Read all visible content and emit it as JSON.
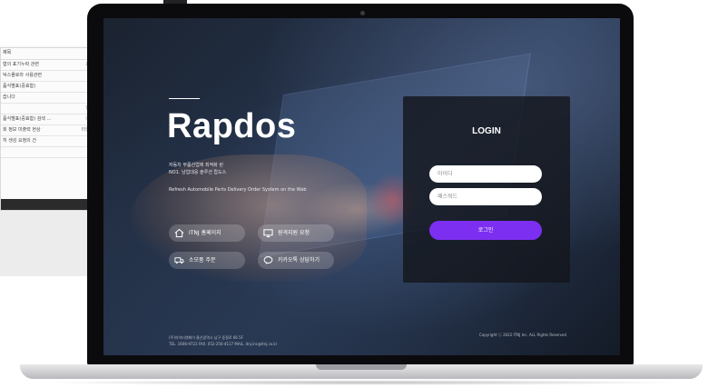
{
  "background_doc": {
    "header": "제목",
    "rows": [
      {
        "text": "협의 표기누락 관련",
        "right": "요"
      },
      {
        "text": "덕스몰로라 사용관련",
        "right": ""
      },
      {
        "text": "품식별표(중효함)",
        "right": ""
      },
      {
        "text": "습니다",
        "right": ""
      },
      {
        "text": "",
        "right": "안"
      },
      {
        "text": "품식별표(중효함) 검색 ...",
        "right": "나"
      },
      {
        "text": "회 정보 미출력 현상",
        "right": "타입"
      },
      {
        "text": "히 생성 요청의 건",
        "right": ""
      },
      {
        "text": "",
        "right": ""
      }
    ]
  },
  "site": {
    "title": "Rapdos",
    "tagline_line1": "자동차 부품산업에 최적화 된",
    "tagline_line2": "NO1. 남업대응 솔루션 랍도스",
    "tagline_en": "Refresh Automobile Parts Delivery Order System on the Web"
  },
  "quick_links": [
    {
      "label": "ITNJ 홈페이지",
      "icon": "home-icon"
    },
    {
      "label": "원격지원 요청",
      "icon": "monitor-icon"
    },
    {
      "label": "소모품 주문",
      "icon": "truck-icon"
    },
    {
      "label": "카카오톡 상담하기",
      "icon": "chat-icon"
    }
  ],
  "login": {
    "title": "LOGIN",
    "id_placeholder": "아이디",
    "pw_placeholder": "패스워드",
    "button_label": "로그인"
  },
  "footer": {
    "address_line1": "(주)아이티엔제이 울산광역시 남구 돋질로 66 5F",
    "address_line2": "TEL. 1666-9723 FAX. 052-256-4117 MAIL. itnj.inc@itnj.co.kr",
    "copyright": "Copyright ⓒ 2022 ITNJ Inc. ALL Rights Reserved"
  },
  "colors": {
    "accent": "#7c2ff0",
    "panel": "#14161c"
  }
}
